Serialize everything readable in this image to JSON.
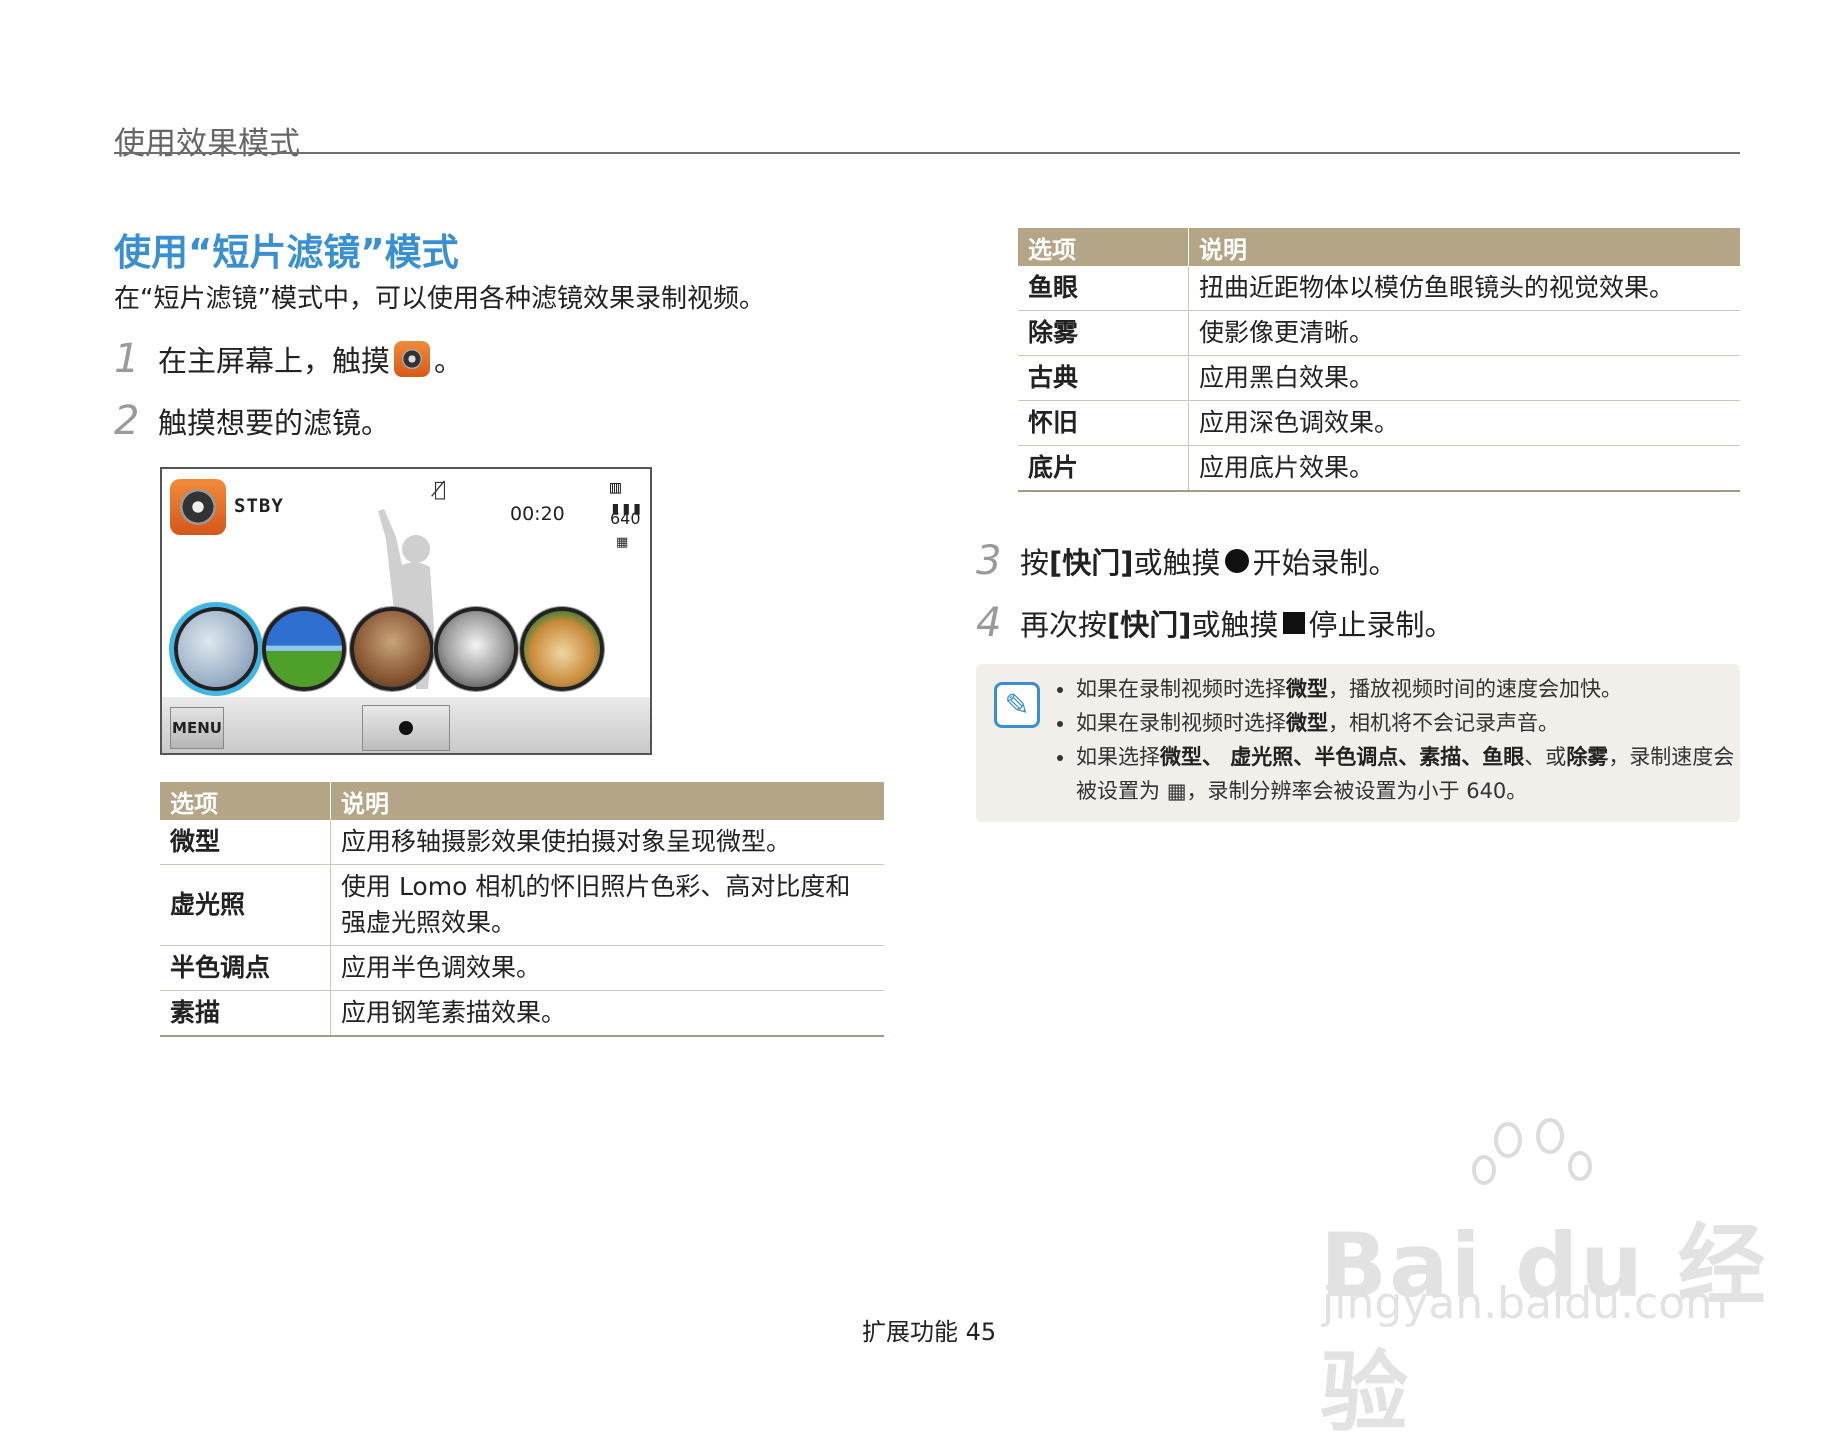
{
  "header": {
    "section_title": "使用效果模式"
  },
  "main": {
    "title": "使用“短片滤镜”模式",
    "intro": "在“短片滤镜”模式中，可以使用各种滤镜效果录制视频。",
    "steps": [
      {
        "num": "1",
        "pre": "在主屏幕上，触摸",
        "post": "。"
      },
      {
        "num": "2",
        "text": "触摸想要的滤镜。"
      },
      {
        "num": "3",
        "pre": "按 ",
        "key": "[快门]",
        "mid": " 或触摸 ",
        "post": " 开始录制。"
      },
      {
        "num": "4",
        "pre": "再次按 ",
        "key": "[快门]",
        "mid": " 或触摸 ",
        "post": " 停止录制。"
      }
    ]
  },
  "camera_screen": {
    "status": "STBY",
    "time": "00:20",
    "resolution": "640",
    "menu_label": "MENU",
    "icons": [
      "movie-filter-icon",
      "mic-off-icon",
      "battery-icon",
      "record-icon"
    ]
  },
  "table_left": {
    "headers": [
      "选项",
      "说明"
    ],
    "rows": [
      {
        "k": "微型",
        "v": "应用移轴摄影效果使拍摄对象呈现微型。"
      },
      {
        "k": "虚光照",
        "v": "使用 Lomo 相机的怀旧照片色彩、高对比度和强虚光照效果。"
      },
      {
        "k": "半色调点",
        "v": "应用半色调效果。"
      },
      {
        "k": "素描",
        "v": "应用钢笔素描效果。"
      }
    ]
  },
  "table_right": {
    "headers": [
      "选项",
      "说明"
    ],
    "rows": [
      {
        "k": "鱼眼",
        "v": "扭曲近距物体以模仿鱼眼镜头的视觉效果。"
      },
      {
        "k": "除雾",
        "v": "使影像更清晰。"
      },
      {
        "k": "古典",
        "v": "应用黑白效果。"
      },
      {
        "k": "怀旧",
        "v": "应用深色调效果。"
      },
      {
        "k": "底片",
        "v": "应用底片效果。"
      }
    ]
  },
  "note": {
    "items": [
      {
        "pre": "如果在录制视频时选择",
        "b": "微型",
        "post": "，播放视频时间的速度会加快。"
      },
      {
        "pre": "如果在录制视频时选择",
        "b": "微型",
        "post": "，相机将不会记录声音。"
      },
      {
        "pre": "如果选择",
        "b": "微型、 虚光照、半色调点、素描、鱼眼",
        "mid": "、或",
        "b2": "除雾",
        "post": "，录制速度会被设置为 ",
        "post2": "，录制分辨率会被设置为小于 640。"
      }
    ]
  },
  "footer": {
    "text": "扩展功能  45"
  },
  "watermark": {
    "line1": "Bai du 经验",
    "line2": "jingyan.baidu.com"
  },
  "colors": {
    "accent": "#3a8fd1",
    "table_header": "#b4a587",
    "note_bg": "#f2eeea"
  }
}
